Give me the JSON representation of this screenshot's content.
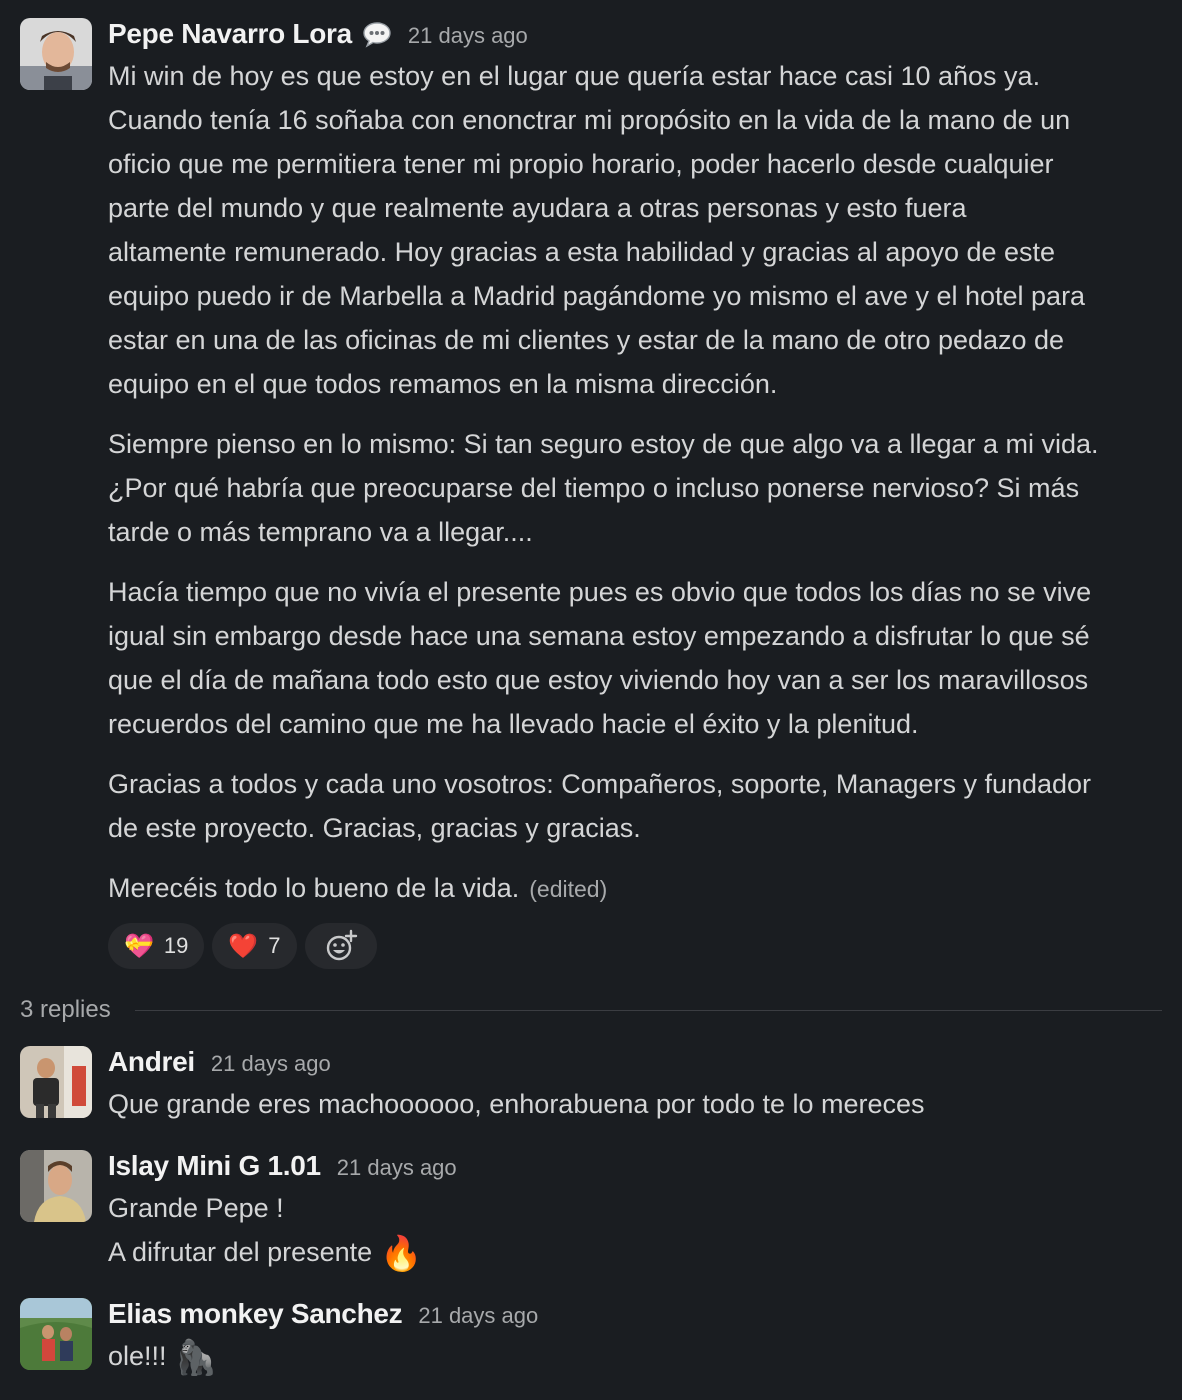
{
  "main_post": {
    "author": "Pepe Navarro Lora",
    "status_icon": "speech-bubble-icon",
    "time": "21 days ago",
    "paragraphs": [
      [
        "Mi win de hoy es que estoy en el lugar que quería estar hace casi 10 años ya.",
        "Cuando tenía 16 soñaba con enonctrar mi propósito en la vida de la mano de un",
        "oficio que me permitiera tener mi propio horario, poder hacerlo desde cualquier",
        "parte del mundo y que realmente ayudara a otras personas y esto fuera",
        "altamente remunerado. Hoy gracias a esta habilidad y gracias al apoyo de este",
        "equipo puedo ir de Marbella a Madrid pagándome yo mismo el ave y el hotel para",
        "estar en una de las oficinas de mi clientes y estar de la mano de otro pedazo de",
        "equipo en el que todos remamos en la misma dirección."
      ],
      [
        "Siempre pienso en lo mismo: Si tan seguro estoy de que algo va a llegar a mi vida.",
        "¿Por qué habría que preocuparse del tiempo o incluso ponerse nervioso? Si más",
        "tarde o más temprano va a llegar...."
      ],
      [
        "Hacía tiempo que no vivía el presente pues es obvio que todos los días no se vive",
        "igual sin embargo desde hace una semana estoy empezando a disfrutar lo que sé",
        "que el día de mañana todo esto que estoy viviendo hoy van a ser los maravillosos",
        "recuerdos del camino que me ha llevado hacie el éxito y la plenitud."
      ],
      [
        "Gracias a todos y cada uno vosotros: Compañeros, soporte, Managers y fundador",
        "de este proyecto. Gracias, gracias y gracias."
      ]
    ],
    "last_line": "Merecéis todo lo bueno de la vida.",
    "edited_label": "(edited)",
    "reactions": [
      {
        "emoji": "💝",
        "count": "19"
      },
      {
        "emoji": "❤️",
        "count": "7"
      }
    ],
    "add_reaction_icon": "add-emoji-icon"
  },
  "replies_label": "3 replies",
  "replies": [
    {
      "author": "Andrei",
      "time": "21 days ago",
      "lines": [
        "Que grande eres machoooooo, enhorabuena por todo te lo mereces"
      ]
    },
    {
      "author": "Islay Mini G 1.01",
      "time": "21 days ago",
      "lines": [
        "Grande Pepe !",
        "A difrutar del presente"
      ],
      "emoji": "🔥"
    },
    {
      "author": "Elias monkey Sanchez",
      "time": "21 days ago",
      "lines": [
        "ole!!!"
      ],
      "emoji": "🦍"
    }
  ]
}
